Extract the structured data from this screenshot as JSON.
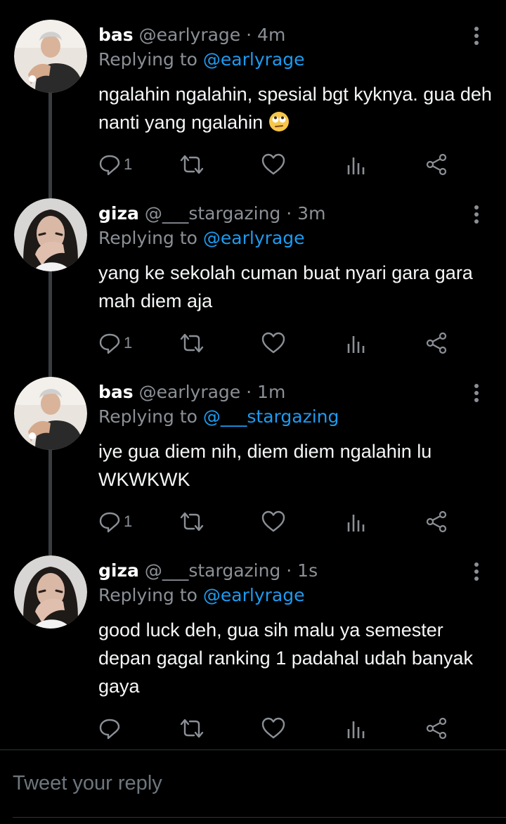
{
  "tweets": [
    {
      "name": "bas",
      "handle": "@earlyrage",
      "dot": "·",
      "time": "4m",
      "replying_prefix": "Replying to",
      "replying_to": "@earlyrage",
      "text": "ngalahin ngalahin, spesial bgt kyknya. gua deh nanti yang ngalahin",
      "emoji": "eye-roll-emoji",
      "reply_count": "1",
      "avatar": "bas-avatar"
    },
    {
      "name": "giza",
      "handle": "@___stargazing",
      "dot": "·",
      "time": "3m",
      "replying_prefix": "Replying to",
      "replying_to": "@earlyrage",
      "text": "yang ke sekolah cuman buat nyari gara gara mah diem aja",
      "reply_count": "1",
      "avatar": "giza-avatar"
    },
    {
      "name": "bas",
      "handle": "@earlyrage",
      "dot": "·",
      "time": "1m",
      "replying_prefix": "Replying to",
      "replying_to": "@___stargazing",
      "text": "iye gua diem nih, diem diem ngalahin lu WKWKWK",
      "reply_count": "1",
      "avatar": "bas-avatar"
    },
    {
      "name": "giza",
      "handle": "@___stargazing",
      "dot": "·",
      "time": "1s",
      "replying_prefix": "Replying to",
      "replying_to": "@earlyrage",
      "text": "good luck deh, gua sih malu ya semester depan gagal ranking 1 padahal udah banyak gaya",
      "reply_count": "",
      "avatar": "giza-avatar"
    }
  ],
  "reply_box": {
    "placeholder": "Tweet your reply"
  },
  "icons": [
    "reply-icon",
    "retweet-icon",
    "like-icon",
    "analytics-icon",
    "share-icon",
    "more-icon"
  ],
  "colors": {
    "background": "#000000",
    "link": "#1d9bf0",
    "muted": "#8b9096",
    "thread_line": "#3a3d40"
  }
}
